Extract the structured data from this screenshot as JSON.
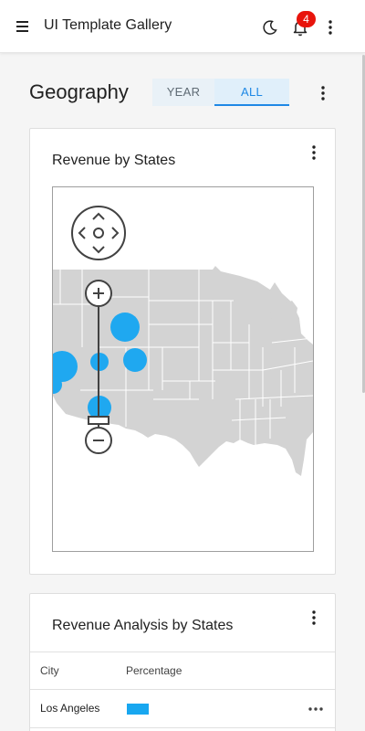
{
  "app": {
    "title": "UI Template Gallery",
    "notification_count": "4"
  },
  "page": {
    "title": "Geography",
    "toggle": {
      "options": [
        "YEAR",
        "ALL"
      ],
      "selected": "ALL"
    }
  },
  "map_card": {
    "title": "Revenue by States",
    "bubble_color": "#1fa8f0",
    "map_color": "#d3d3d3"
  },
  "table_card": {
    "title": "Revenue Analysis by States",
    "columns": [
      "City",
      "Percentage"
    ],
    "rows": [
      {
        "city": "Los Angeles",
        "percentage": 0.1
      }
    ]
  },
  "colors": {
    "accent": "#1e88e5",
    "badge": "#e8140c",
    "bar": "#18a7f0"
  }
}
